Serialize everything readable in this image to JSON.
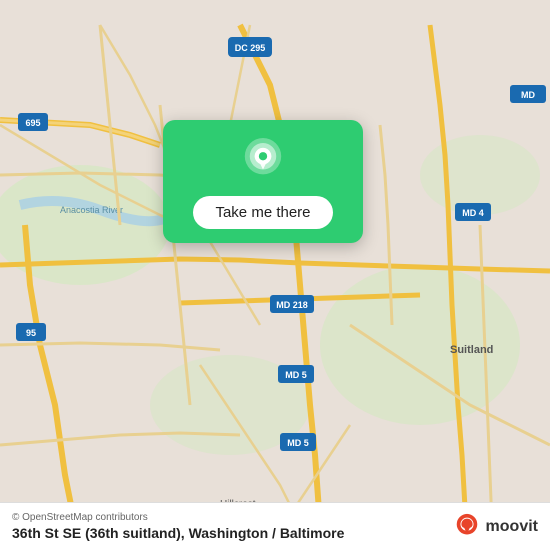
{
  "map": {
    "bg_color": "#e8e0d8",
    "accent_color": "#2ecc71"
  },
  "card": {
    "button_label": "Take me there",
    "bg_color": "#2ecc71"
  },
  "bottom_bar": {
    "osm_credit": "© OpenStreetMap contributors",
    "location_title": "36th St SE (36th suitland), Washington / Baltimore",
    "moovit_label": "moovit"
  },
  "icons": {
    "pin": "pin-icon",
    "moovit": "moovit-icon"
  }
}
